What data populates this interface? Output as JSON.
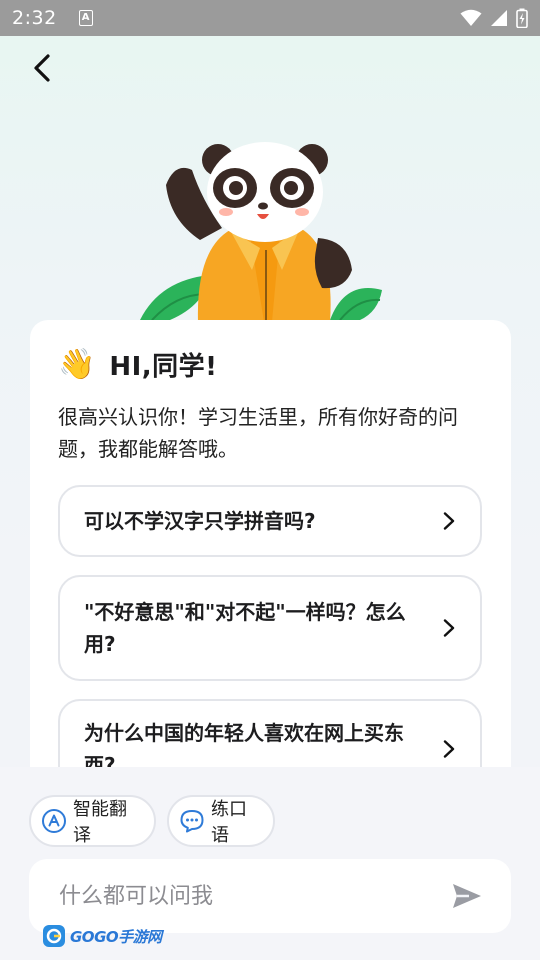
{
  "status_bar": {
    "time": "2:32",
    "notification_glyph": "A"
  },
  "greeting": {
    "emoji": "👋",
    "title": "HI,同学!"
  },
  "intro_text": "很高兴认识你！学习生活里，所有你好奇的问题，我都能解答哦。",
  "suggested_questions": [
    {
      "text": "可以不学汉字只学拼音吗?"
    },
    {
      "text": "\"不好意思\"和\"对不起\"一样吗？怎么用?"
    },
    {
      "text": "为什么中国的年轻人喜欢在网上买东西?"
    }
  ],
  "chips": [
    {
      "label": "智能翻译",
      "icon": "translate-icon"
    },
    {
      "label": "练口语",
      "icon": "chat-bubble-icon"
    }
  ],
  "input": {
    "placeholder": "什么都可以问我",
    "value": ""
  },
  "watermark": {
    "text": "GOGO手游网"
  },
  "colors": {
    "accent_blue": "#2f7bd8",
    "chip_border": "#e2e4ea",
    "send_icon": "#9a9ca3"
  }
}
